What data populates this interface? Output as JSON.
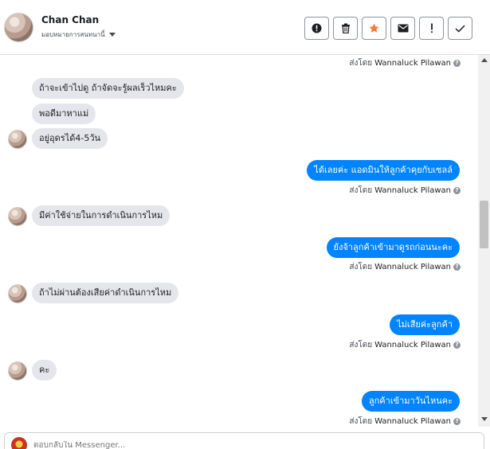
{
  "header": {
    "name": "Chan Chan",
    "subtitle": "มอบหมายการสนทนานี้",
    "actions": [
      {
        "icon": "alert-circle-icon",
        "label": "mark-spam"
      },
      {
        "icon": "trash-icon",
        "label": "delete"
      },
      {
        "icon": "star-icon",
        "label": "follow-up",
        "color": "#f5793b"
      },
      {
        "icon": "mail-icon",
        "label": "mark-unread"
      },
      {
        "icon": "exclamation-icon",
        "label": "important"
      },
      {
        "icon": "check-icon",
        "label": "done"
      }
    ]
  },
  "sent_by_prefix": "ส่งโดย",
  "sender_name": "Wannaluck Pilawan",
  "messages": [
    {
      "dir": "in",
      "text": "ถ้าจะเข้าไปดู ถ้าจัดจะรู้ผลเร็วไหมคะ"
    },
    {
      "dir": "in",
      "text": "พอดีมาหาแม่"
    },
    {
      "dir": "in",
      "text": "อยู่อุดรได้4-5วัน"
    },
    {
      "dir": "out",
      "text": "ได้เลยค่ะ แอดมินให้ลูกค้าคุยกับเซลล์"
    },
    {
      "dir": "in",
      "text": "มีค่าใช้จ่ายในการดำเนินการไหม"
    },
    {
      "dir": "out",
      "text": "ยังจ้าลูกค้าเข้ามาดูรถก่อนนะคะ"
    },
    {
      "dir": "in",
      "text": "ถ้าไม่ผ่านต้องเสียค่าดำเนินการไหม"
    },
    {
      "dir": "out",
      "text": "ไม่เสียค่ะลูกค้า"
    },
    {
      "dir": "in",
      "text": "คะ"
    },
    {
      "dir": "out",
      "text": "ลูกค้าเข้ามาวันไหนคะ"
    }
  ],
  "composer": {
    "placeholder": "ตอบกลับใน Messenger..."
  },
  "colors": {
    "outgoing_bubble": "#0084ff",
    "incoming_bubble": "#e4e6eb"
  }
}
